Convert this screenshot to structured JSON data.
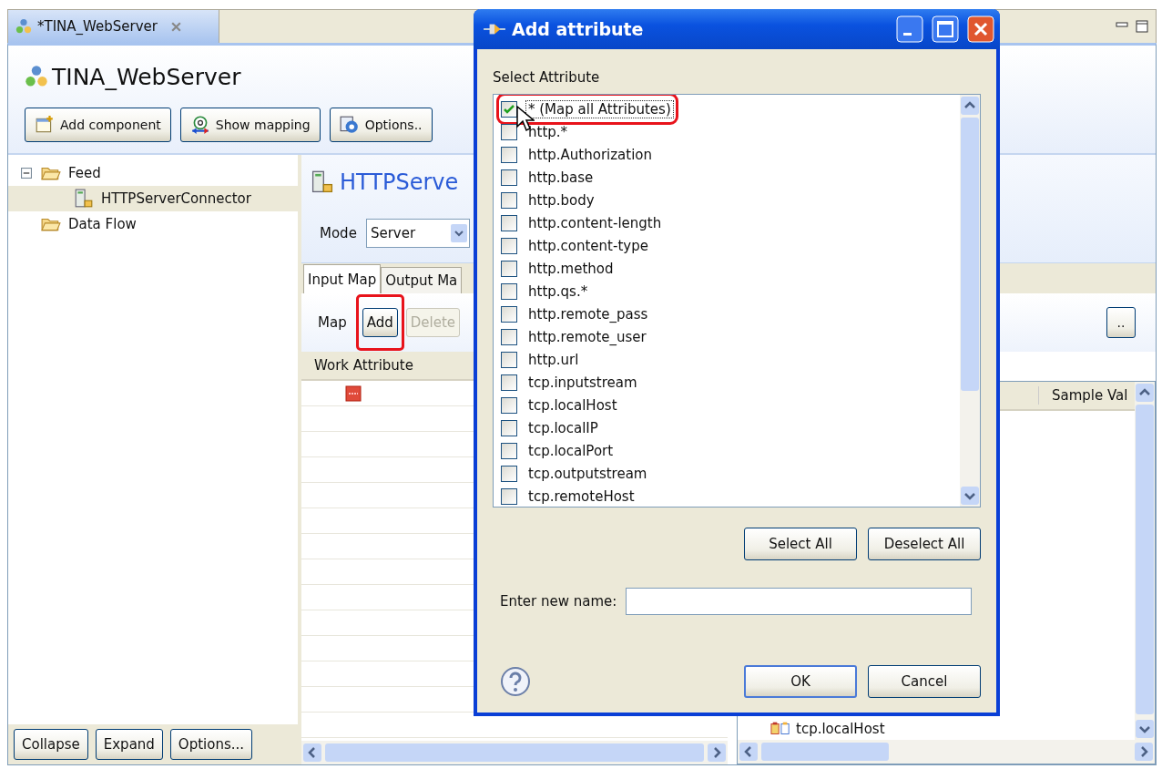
{
  "editor_tab": {
    "title": "*TINA_WebServer"
  },
  "header": {
    "title": "TINA_WebServer",
    "buttons": [
      {
        "label": "Add component",
        "kind": "add"
      },
      {
        "label": "Show mapping",
        "kind": "mapping"
      },
      {
        "label": "Options..",
        "kind": "options"
      }
    ]
  },
  "tree": {
    "items": [
      {
        "label": "Feed",
        "kind": "folder",
        "expanded": true,
        "selected": false,
        "children": [
          {
            "label": "HTTPServerConnector",
            "kind": "connector",
            "selected": true
          }
        ]
      },
      {
        "label": "Data Flow",
        "kind": "folder",
        "selected": false
      }
    ]
  },
  "tree_buttons": [
    "Collapse",
    "Expand",
    "Options..."
  ],
  "component": {
    "title": "HTTPServe",
    "mode_label": "Mode",
    "mode_value": "Server"
  },
  "map_tabs": [
    {
      "label": "Input Map",
      "selected": true
    },
    {
      "label": "Output Ma",
      "selected": false
    }
  ],
  "map_toolbar": {
    "label": "Map",
    "buttons": [
      {
        "label": "Add",
        "disabled": false,
        "highlighted": true
      },
      {
        "label": "Delete",
        "disabled": true,
        "highlighted": false
      }
    ],
    "more_button": ".."
  },
  "work_table": {
    "columns": [
      "Work Attribute"
    ],
    "rows": [
      {
        "kind": "error"
      }
    ]
  },
  "sample_table": {
    "columns": [
      "Sample Val"
    ],
    "rows": [
      {
        "label": "tcp.localHost"
      }
    ]
  },
  "dialog": {
    "title": "Add attribute",
    "list_label": "Select Attribute",
    "attributes": [
      {
        "label": "* (Map all Attributes)",
        "checked": true,
        "focused": true,
        "highlighted": true
      },
      {
        "label": "http.*",
        "checked": false,
        "focused": false,
        "highlighted": false
      },
      {
        "label": "http.Authorization",
        "checked": false,
        "focused": false,
        "highlighted": false
      },
      {
        "label": "http.base",
        "checked": false,
        "focused": false,
        "highlighted": false
      },
      {
        "label": "http.body",
        "checked": false,
        "focused": false,
        "highlighted": false
      },
      {
        "label": "http.content-length",
        "checked": false,
        "focused": false,
        "highlighted": false
      },
      {
        "label": "http.content-type",
        "checked": false,
        "focused": false,
        "highlighted": false
      },
      {
        "label": "http.method",
        "checked": false,
        "focused": false,
        "highlighted": false
      },
      {
        "label": "http.qs.*",
        "checked": false,
        "focused": false,
        "highlighted": false
      },
      {
        "label": "http.remote_pass",
        "checked": false,
        "focused": false,
        "highlighted": false
      },
      {
        "label": "http.remote_user",
        "checked": false,
        "focused": false,
        "highlighted": false
      },
      {
        "label": "http.url",
        "checked": false,
        "focused": false,
        "highlighted": false
      },
      {
        "label": "tcp.inputstream",
        "checked": false,
        "focused": false,
        "highlighted": false
      },
      {
        "label": "tcp.localHost",
        "checked": false,
        "focused": false,
        "highlighted": false
      },
      {
        "label": "tcp.localIP",
        "checked": false,
        "focused": false,
        "highlighted": false
      },
      {
        "label": "tcp.localPort",
        "checked": false,
        "focused": false,
        "highlighted": false
      },
      {
        "label": "tcp.outputstream",
        "checked": false,
        "focused": false,
        "highlighted": false
      },
      {
        "label": "tcp.remoteHost",
        "checked": false,
        "focused": false,
        "highlighted": false
      }
    ],
    "select_buttons": [
      "Select All",
      "Deselect All"
    ],
    "name_label": "Enter new name:",
    "buttons": [
      {
        "label": "OK",
        "default": true
      },
      {
        "label": "Cancel",
        "default": false
      }
    ]
  }
}
